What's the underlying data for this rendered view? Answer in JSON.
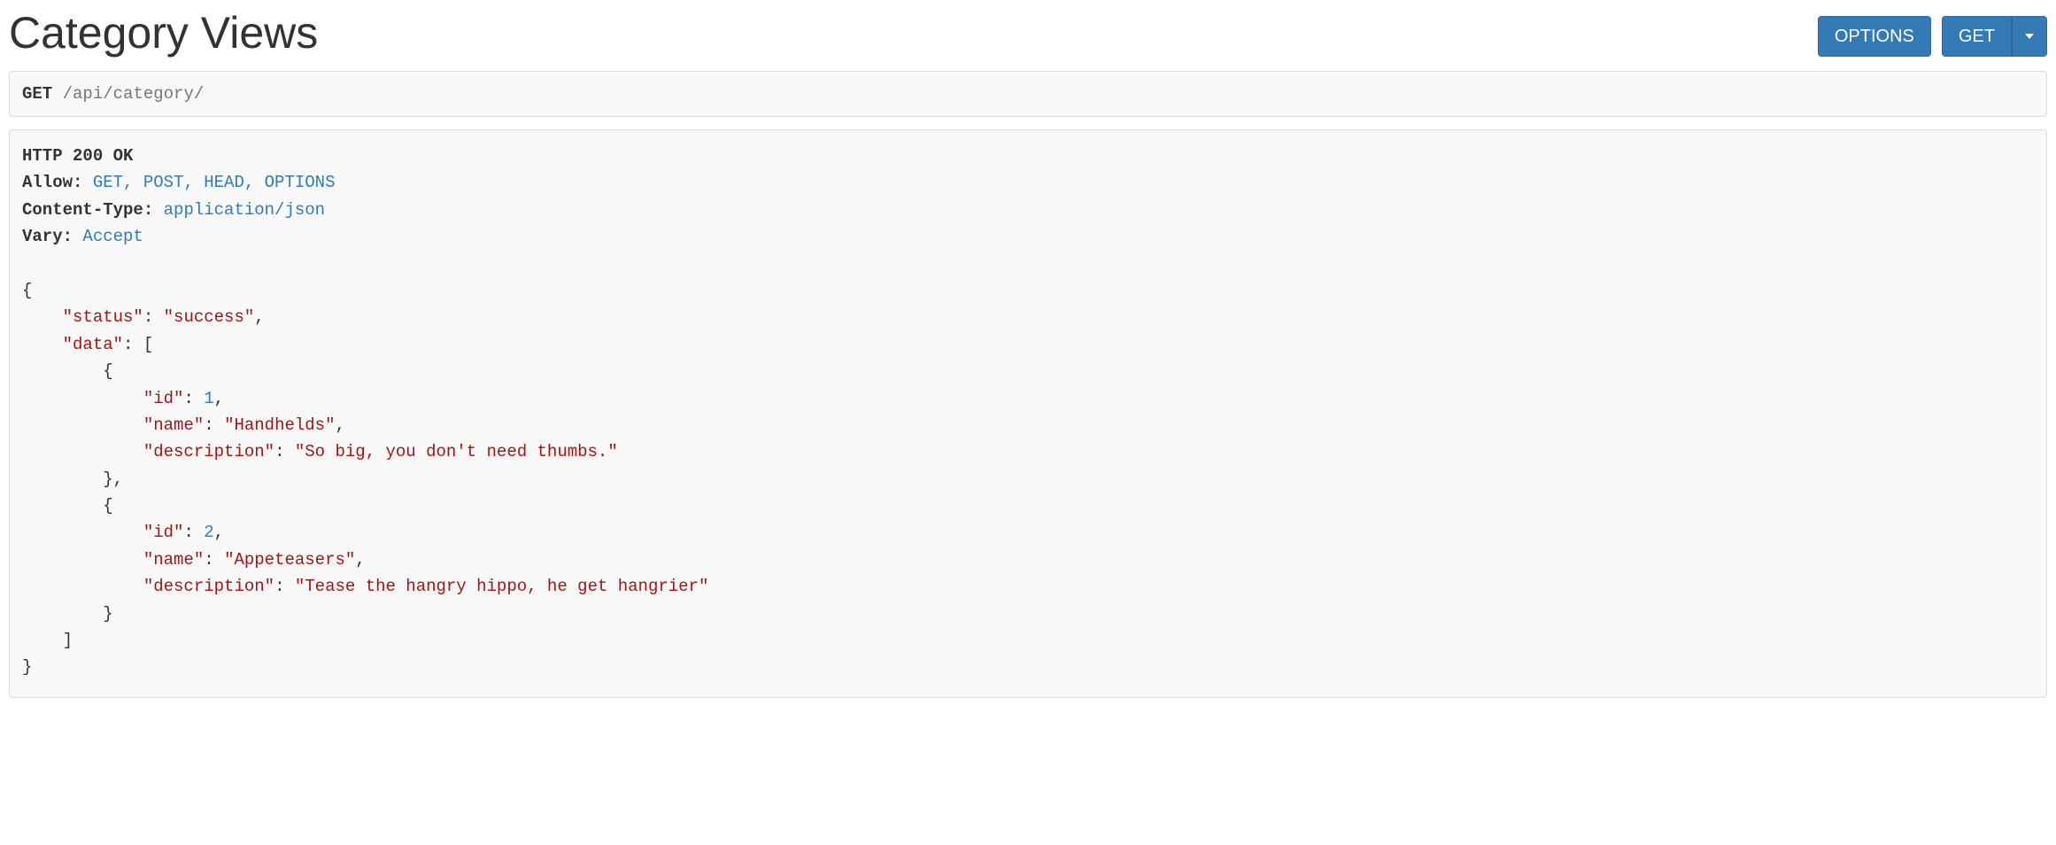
{
  "title": "Category Views",
  "buttons": {
    "options": "OPTIONS",
    "get": "GET"
  },
  "request": {
    "method": "GET",
    "path": "/api/category/"
  },
  "response": {
    "status_line": "HTTP 200 OK",
    "headers": {
      "allow_label": "Allow:",
      "allow_value": "GET, POST, HEAD, OPTIONS",
      "content_type_label": "Content-Type:",
      "content_type_value": "application/json",
      "vary_label": "Vary:",
      "vary_value": "Accept"
    },
    "body": {
      "status_key": "\"status\"",
      "status_val": "\"success\"",
      "data_key": "\"data\"",
      "items": [
        {
          "id_key": "\"id\"",
          "id_val": "1",
          "name_key": "\"name\"",
          "name_val": "\"Handhelds\"",
          "desc_key": "\"description\"",
          "desc_val": "\"So big, you don't need thumbs.\""
        },
        {
          "id_key": "\"id\"",
          "id_val": "2",
          "name_key": "\"name\"",
          "name_val": "\"Appeteasers\"",
          "desc_key": "\"description\"",
          "desc_val": "\"Tease the hangry hippo, he get hangrier\""
        }
      ]
    }
  }
}
